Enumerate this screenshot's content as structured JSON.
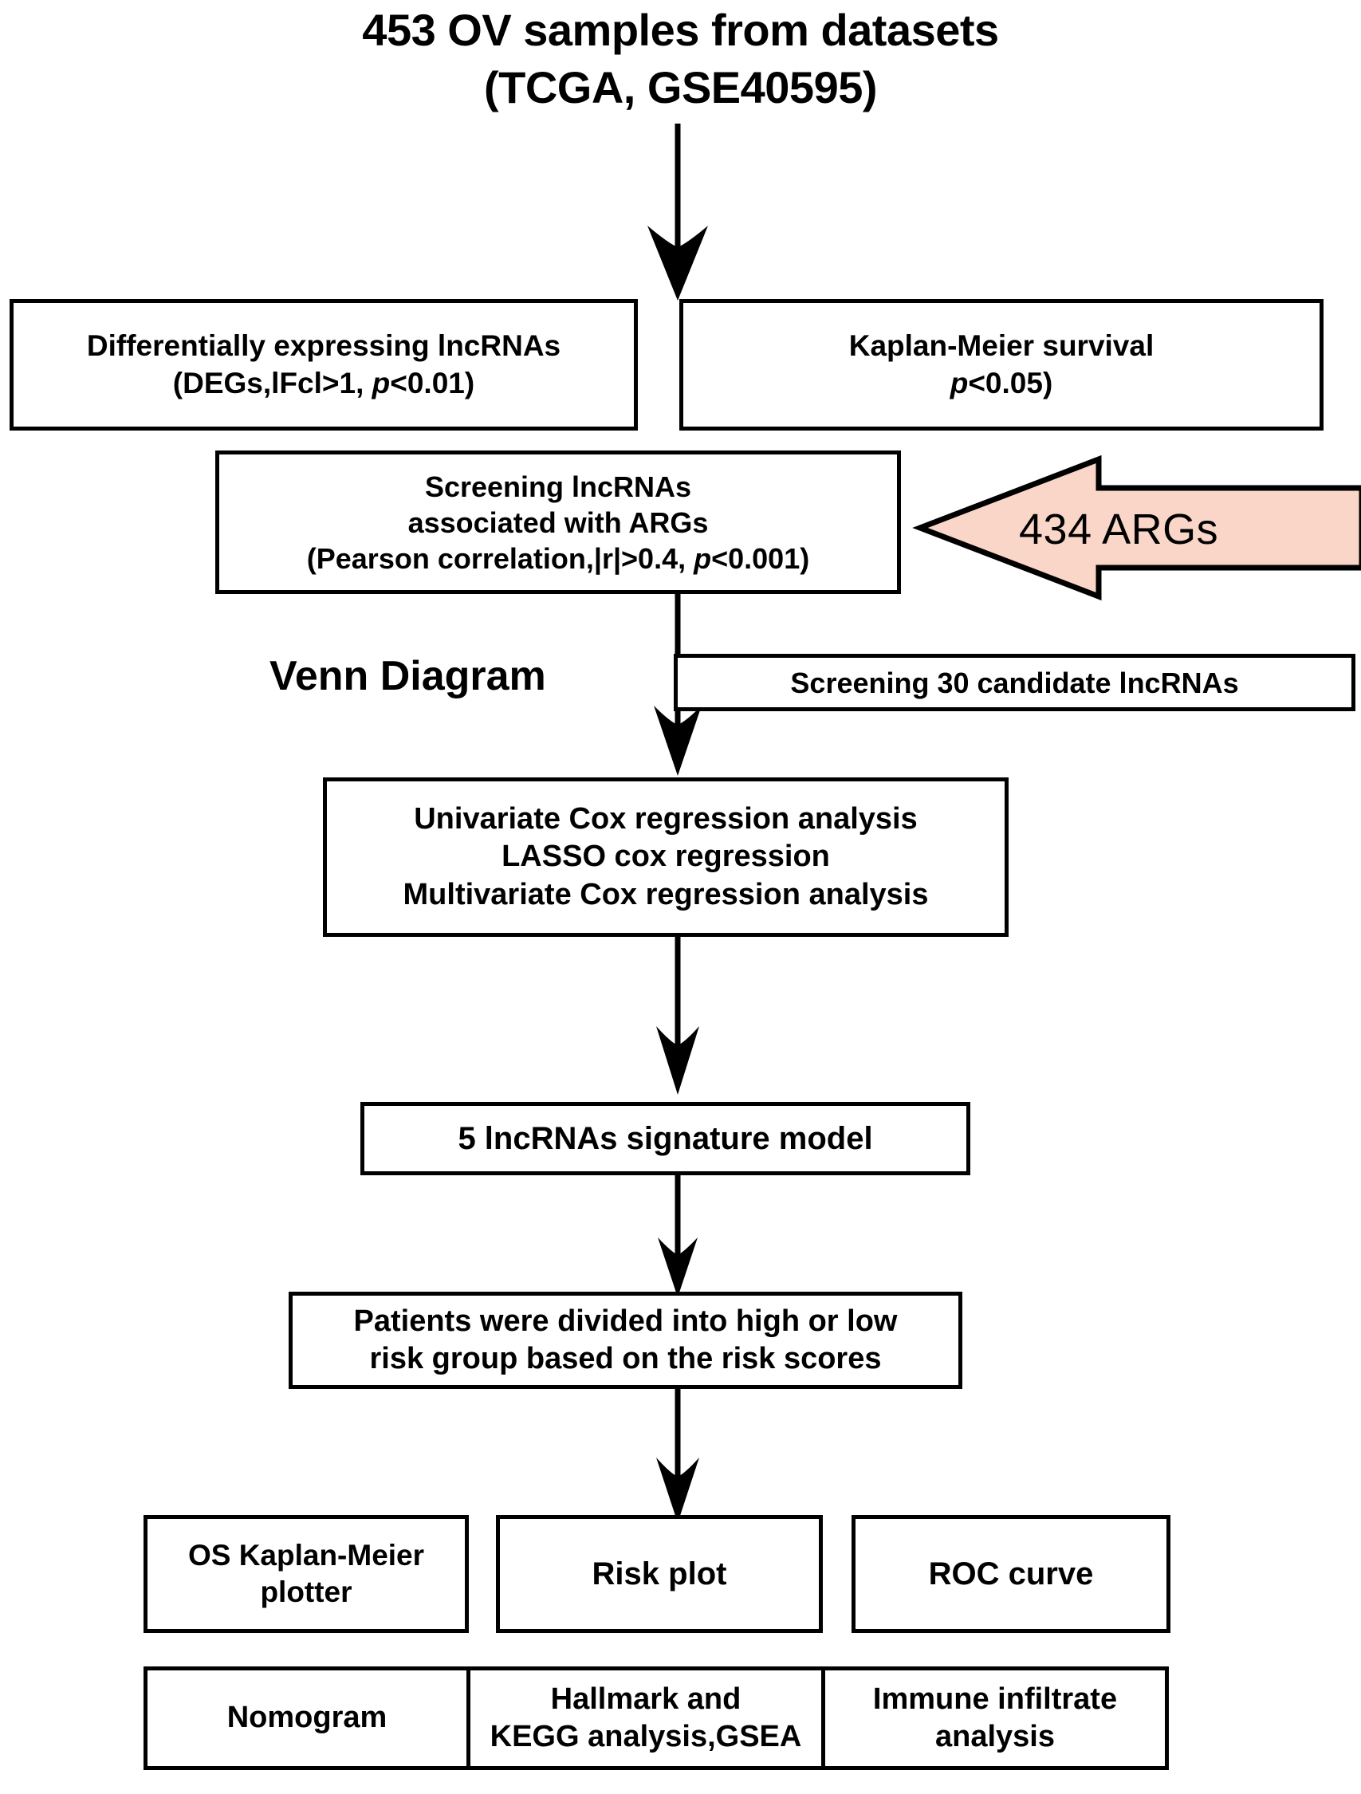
{
  "title": {
    "line1": "453 OV samples from datasets",
    "line2": "(TCGA, GSE40595)"
  },
  "colors": {
    "arrow_fill": "#fad6c8",
    "stroke": "#000000",
    "background": "#ffffff"
  },
  "boxes": {
    "deg": {
      "line1": "Differentially expressing lncRNAs",
      "line2_pre": "(DEGs,lFcl>1, ",
      "line2_ital": "p",
      "line2_post": "<0.01)"
    },
    "km_survival": {
      "line1": "Kaplan-Meier survival",
      "line2_ital": "p",
      "line2_post": "<0.05)"
    },
    "screening_lncrnas": {
      "line1": "Screening lncRNAs",
      "line2": "associated with ARGs",
      "line3_pre": "(Pearson correlation,|r|>0.4, ",
      "line3_ital": "p",
      "line3_post": "<0.001)"
    },
    "candidate_lncrnas": {
      "line1": "Screening 30  candidate lncRNAs"
    },
    "cox": {
      "line1": "Univariate Cox regression analysis",
      "line2": "LASSO cox regression",
      "line3": "Multivariate Cox regression analysis"
    },
    "signature": {
      "line1": "5  lncRNAs signature model"
    },
    "risk_groups": {
      "line1": "Patients were divided into high or low",
      "line2": "risk group based on the risk scores"
    },
    "os_km_plotter": {
      "line1": "OS Kaplan-Meier",
      "line2": "plotter"
    },
    "risk_plot": {
      "line1": "Risk plot"
    },
    "roc_curve": {
      "line1": "ROC curve"
    },
    "nomogram": {
      "line1": "Nomogram"
    },
    "hallmark_kegg": {
      "line1": "Hallmark and",
      "line2": "KEGG analysis,GSEA"
    },
    "immune_infiltrate": {
      "line1": "Immune infiltrate",
      "line2": "analysis"
    }
  },
  "labels": {
    "venn_diagram": "Venn Diagram",
    "args_arrow": "434 ARGs"
  }
}
